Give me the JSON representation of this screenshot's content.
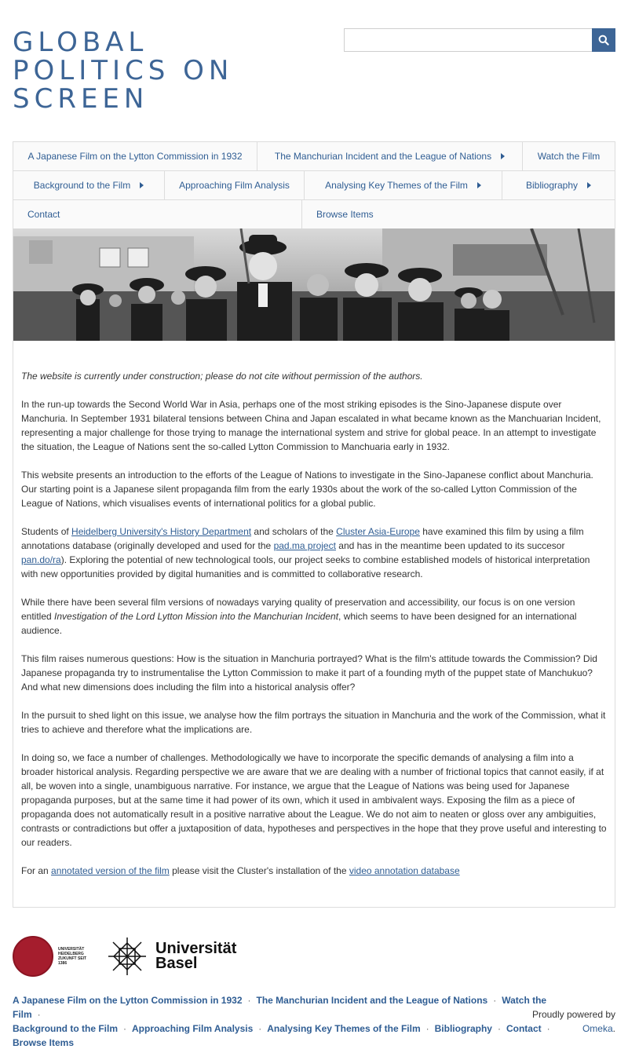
{
  "site": {
    "title": "GLOBAL POLITICS ON SCREEN"
  },
  "search": {
    "placeholder": ""
  },
  "nav": {
    "row1": [
      {
        "label": "A Japanese Film on the Lytton Commission in 1932",
        "has_submenu": false
      },
      {
        "label": "The Manchurian Incident and the League of Nations",
        "has_submenu": true
      },
      {
        "label": "Watch the Film",
        "has_submenu": false
      }
    ],
    "row2": [
      {
        "label": "Background to the Film",
        "has_submenu": true
      },
      {
        "label": "Approaching Film Analysis",
        "has_submenu": false
      },
      {
        "label": "Analysing Key Themes of the Film",
        "has_submenu": true
      },
      {
        "label": "Bibliography",
        "has_submenu": true
      }
    ],
    "row3": [
      {
        "label": "Contact",
        "has_submenu": false
      },
      {
        "label": "Browse Items",
        "has_submenu": false
      }
    ]
  },
  "content": {
    "notice": "The website is currently under construction; please do not cite without permission of the authors.",
    "p1": "In the run-up towards the Second World War in Asia, perhaps one of the most striking episodes is the Sino-Japanese dispute over Manchuria. In September 1931 bilateral tensions between China and Japan escalated in what became known as the Manchuarian Incident, representing a major challenge for those trying to manage the international system and strive for global peace. In an attempt to investigate the situation, the League of Nations sent the so-called Lytton Commission to Manchuaria early in 1932.",
    "p2": "This website presents an introduction to the efforts of the League of Nations to investigate in the Sino-Japanese conflict about Manchuria. Our starting point is a Japanese silent propaganda film from the early 1930s about the work of the so-called Lytton Commission of the League of Nations, which visualises events of international politics for a global public.",
    "p3": {
      "t1": "Students of ",
      "link1": "Heidelberg University's History Department",
      "t2": " and scholars of the ",
      "link2": "Cluster Asia-Europe",
      "t3": " have examined this film by using a film annotations database (originally developed and used for the ",
      "link3": "pad.ma project",
      "t4": " and has in the meantime been updated to its succesor ",
      "link4": "pan.do/ra",
      "t5": "). Exploring the potential of new technological tools, our project seeks to combine established models of historical interpretation with new opportunities provided by digital humanities and is committed to collaborative research."
    },
    "p4": {
      "t1": "While there have been several film versions of nowadays varying quality of preservation and accessibility, our focus is on one version entitled ",
      "em": "Investigation of the Lord Lytton Mission into the Manchurian Incident",
      "t2": ", which seems to have been designed for an international audience."
    },
    "p5": "This film raises numerous questions: How is the situation in Manchuria portrayed? What is the film's attitude towards the Commission? Did Japanese propaganda try to instrumentalise the Lytton Commission to make it part of a founding myth of the puppet state of Manchukuo? And what new dimensions does including the film into a historical analysis offer?",
    "p6": "In the pursuit to shed light on this issue, we analyse how the film portrays the situation in Manchuria and the work of the Commission, what it tries to achieve and therefore what the implications are.",
    "p7": "In doing so, we face a number of challenges. Methodologically we have to incorporate the specific demands of analysing a film into a broader historical analysis. Regarding perspective we are aware that we are dealing with a number of frictional topics that cannot easily, if at all, be woven into a single, unambiguous narrative. For instance, we argue that the League of Nations was being used for Japanese propaganda purposes, but at the same time it had power of its own, which it used in ambivalent ways. Exposing the film as a piece of propaganda does not automatically result in a positive narrative about the League. We do not aim to neaten or gloss over any ambiguities, contrasts or contradictions but offer a juxtaposition of data, hypotheses and perspectives in the hope that they prove useful and interesting to our readers.",
    "p8": {
      "t1": "For an ",
      "link1": "annotated version of the film",
      "t2": " please visit the Cluster's installation of the ",
      "link2": "video annotation database"
    }
  },
  "footer": {
    "heidelberg_logo_text": "UNIVERSITÄT HEIDELBERG ZUKUNFT SEIT 1386",
    "basel_logo_text_1": "Universität",
    "basel_logo_text_2": "Basel",
    "links": [
      "A Japanese Film on the Lytton Commission in 1932",
      "The Manchurian Incident and the League of Nations",
      "Watch the Film",
      "Background to the Film",
      "Approaching Film Analysis",
      "Analysing Key Themes of the Film",
      "Bibliography",
      "Contact",
      "Browse Items"
    ],
    "powered_text": "Proudly powered by ",
    "powered_link": "Omeka",
    "powered_end": "."
  },
  "colors": {
    "accent": "#3d6596",
    "link": "#2f5d93",
    "border": "#dddddd"
  }
}
